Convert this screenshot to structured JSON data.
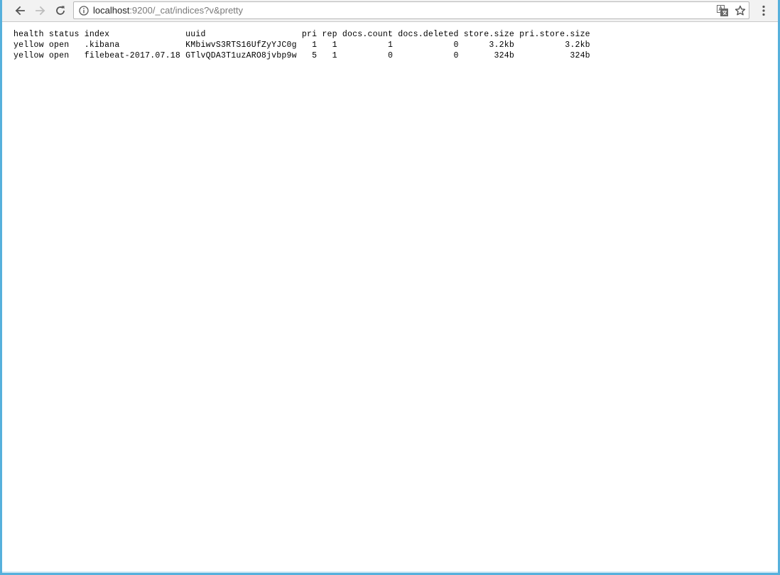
{
  "browser": {
    "back_icon": "arrow-left-icon",
    "forward_icon": "arrow-right-icon",
    "reload_icon": "reload-icon",
    "info_icon": "info-icon",
    "translate_icon": "translate-icon",
    "star_icon": "star-icon",
    "menu_icon": "kebab-menu-icon",
    "url_host": "localhost",
    "url_rest": ":9200/_cat/indices?v&pretty"
  },
  "cat_indices": {
    "header": "health status index               uuid                   pri rep docs.count docs.deleted store.size pri.store.size",
    "rows": [
      "yellow open   .kibana             KMbiwvS3RTS16UfZyYJC0g   1   1          1            0      3.2kb          3.2kb",
      "yellow open   filebeat-2017.07.18 GTlvQDA3T1uzARO8jvbp9w   5   1          0            0       324b           324b"
    ]
  },
  "colors": {
    "toolbar_bg": "#f2f2f2",
    "window_border": "#56b0dc",
    "url_host": "#202020",
    "url_rest": "#7a7a7a"
  }
}
